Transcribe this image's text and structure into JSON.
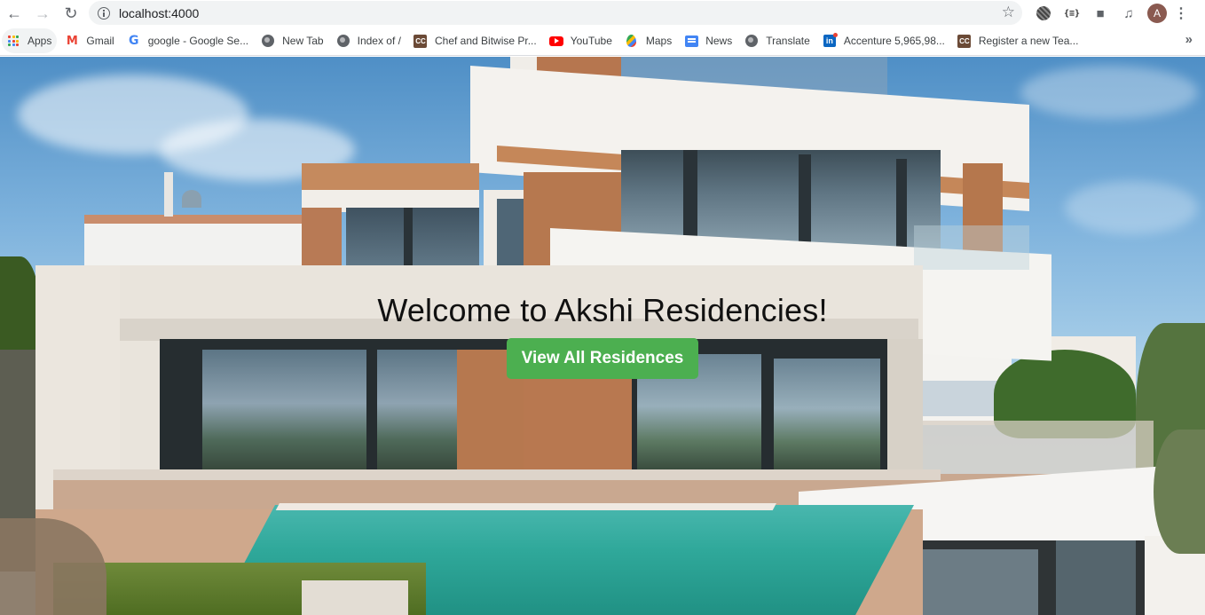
{
  "browser": {
    "url": "localhost:4000",
    "avatar_letter": "A"
  },
  "bookmarks": [
    {
      "label": "Apps",
      "icon": "apps-icon"
    },
    {
      "label": "Gmail",
      "icon": "gmail-icon"
    },
    {
      "label": "google - Google Se...",
      "icon": "google-icon"
    },
    {
      "label": "New Tab",
      "icon": "globe-icon"
    },
    {
      "label": "Index of /",
      "icon": "globe-icon"
    },
    {
      "label": "Chef and Bitwise Pr...",
      "icon": "codechef-icon"
    },
    {
      "label": "YouTube",
      "icon": "youtube-icon"
    },
    {
      "label": "Maps",
      "icon": "maps-icon"
    },
    {
      "label": "News",
      "icon": "news-icon"
    },
    {
      "label": "Translate",
      "icon": "globe-icon"
    },
    {
      "label": "Accenture 5,965,98...",
      "icon": "linkedin-icon"
    },
    {
      "label": "Register a new Tea...",
      "icon": "codechef-icon"
    }
  ],
  "hero": {
    "title": "Welcome to Akshi Residencies!",
    "button_label": "View All Residences",
    "button_color": "#4caf50"
  }
}
